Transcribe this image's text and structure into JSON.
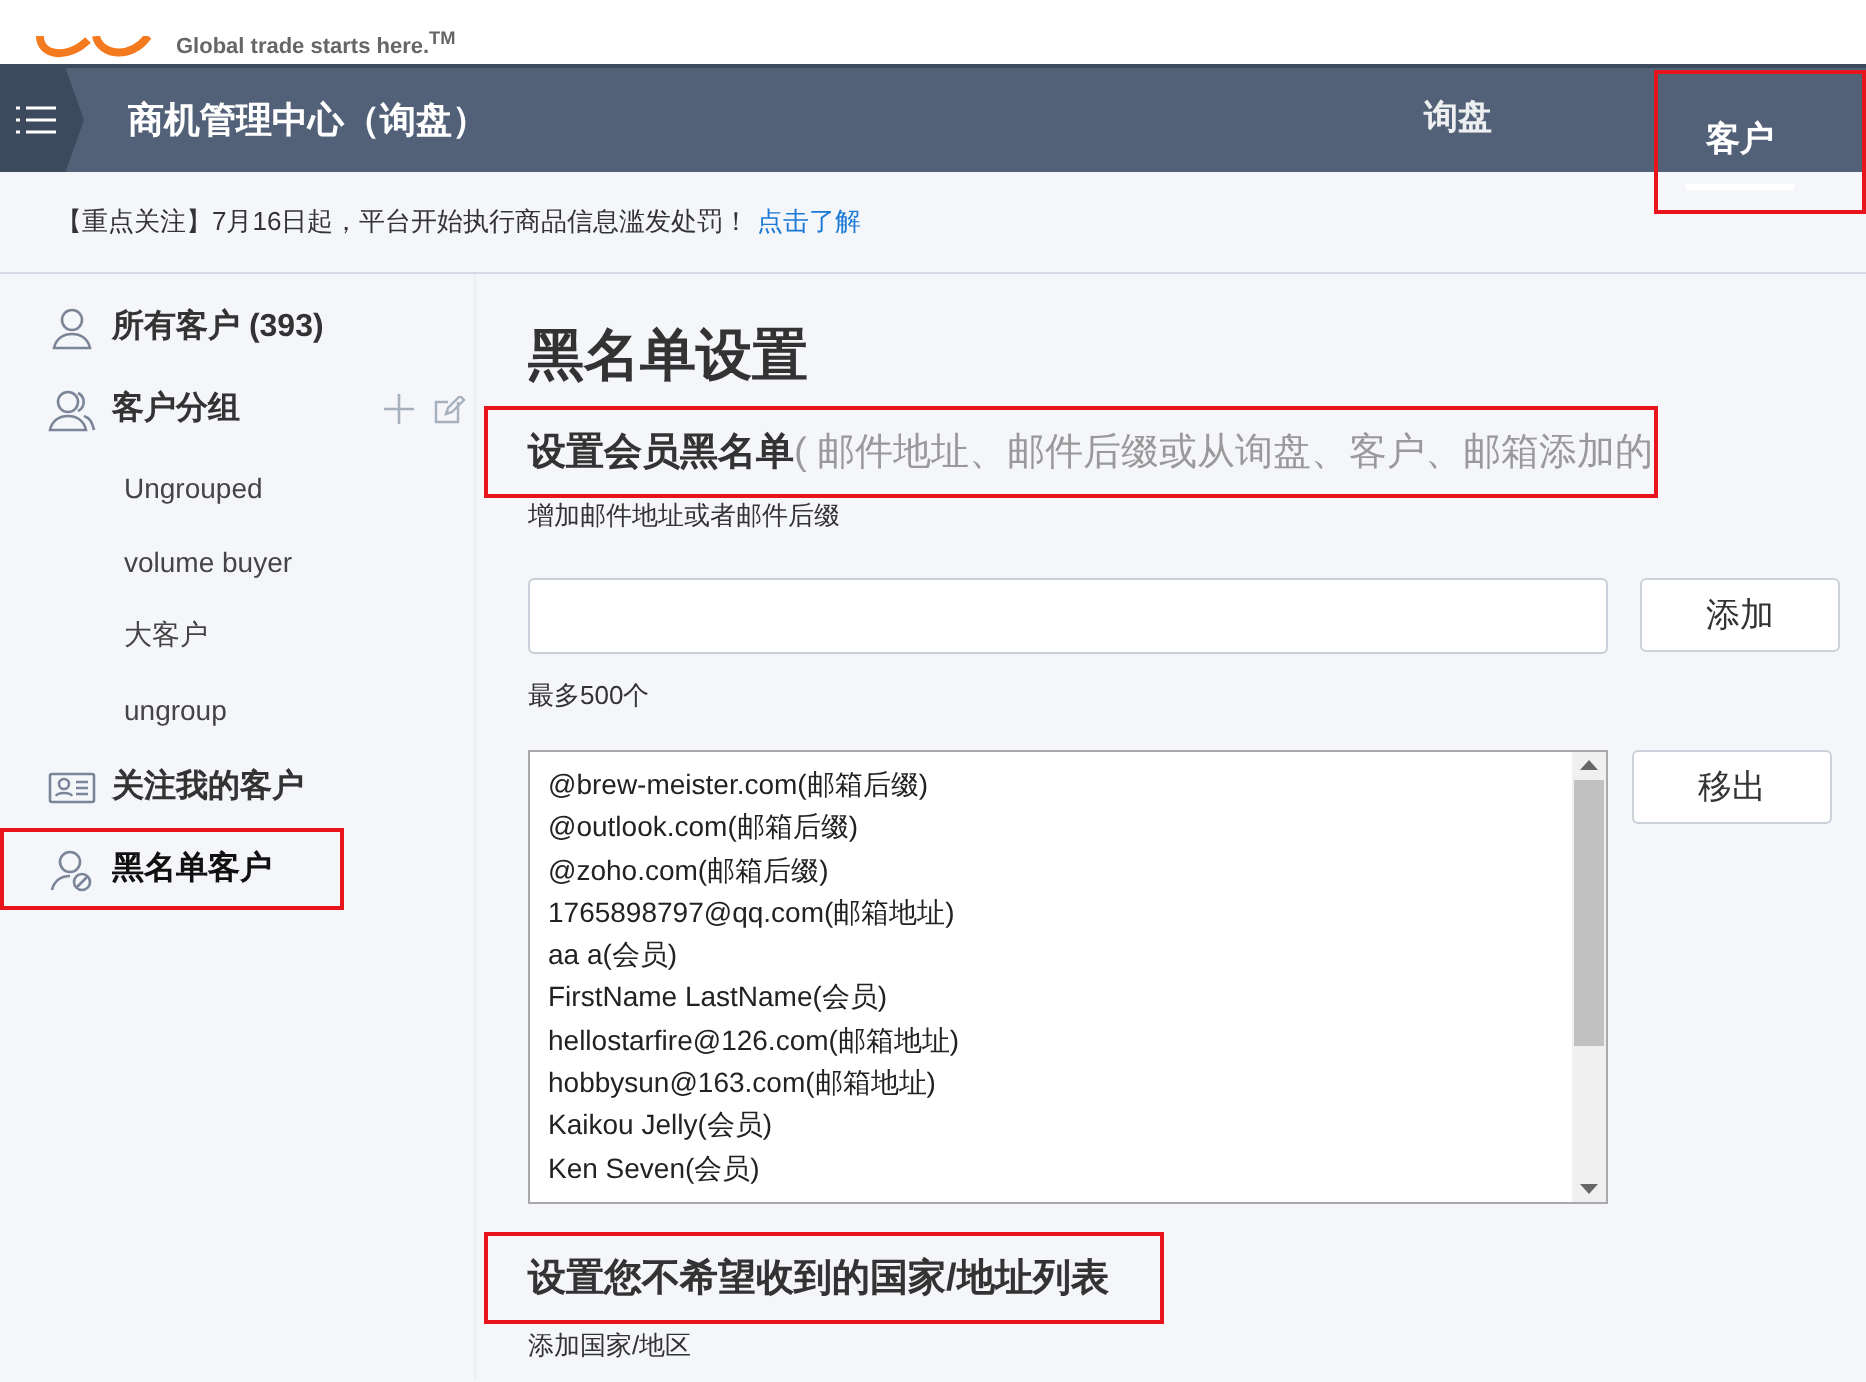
{
  "brand": {
    "tagline": "Global trade starts here.$^{TM}$"
  },
  "nav": {
    "title": "商机管理中心（询盘）",
    "tabs": [
      {
        "label": "询盘",
        "selected": false,
        "highlighted": false
      },
      {
        "label": "客户",
        "selected": true,
        "highlighted": true
      }
    ]
  },
  "notice": {
    "text": "【重点关注】7月16日起，平台开始执行商品信息滥发处罚！",
    "link": "点击了解"
  },
  "sidebar": {
    "items": [
      {
        "kind": "user",
        "label": "所有客户 (393)",
        "selected": false,
        "highlighted": false
      },
      {
        "kind": "group",
        "label": "客户分组",
        "selected": false,
        "highlighted": false,
        "children": [
          {
            "label": "Ungrouped",
            "selected": false
          },
          {
            "label": "volume buyer",
            "selected": false
          },
          {
            "label": "大客户",
            "selected": false
          },
          {
            "label": "ungroup",
            "selected": false
          }
        ]
      },
      {
        "kind": "card",
        "label": "关注我的客户",
        "selected": false,
        "highlighted": false
      },
      {
        "kind": "blocked",
        "label": "黑名单客户",
        "selected": true,
        "highlighted": true
      }
    ]
  },
  "main": {
    "title": "黑名单设置",
    "member_section": {
      "title": "设置会员黑名单",
      "note": "( 邮件地址、邮件后缀或从询盘、客户、邮箱添加的",
      "highlighted": true,
      "field_label": "增加邮件地址或者邮件后缀",
      "add_button": "添加",
      "limit": "最多500个",
      "remove_button": "移出",
      "entries": [
        "@brew-meister.com(邮箱后缀)",
        "@outlook.com(邮箱后缀)",
        "@zoho.com(邮箱后缀)",
        "1765898797@qq.com(邮箱地址)",
        "aa a(会员)",
        "FirstName LastName(会员)",
        "hellostarfire@126.com(邮箱地址)",
        "hobbysun@163.com(邮箱地址)",
        "Kaikou Jelly(会员)",
        "Ken Seven(会员)"
      ]
    },
    "country_section": {
      "title": "设置您不希望收到的国家/地址列表",
      "highlighted": true,
      "field_label": "添加国家/地区"
    }
  }
}
